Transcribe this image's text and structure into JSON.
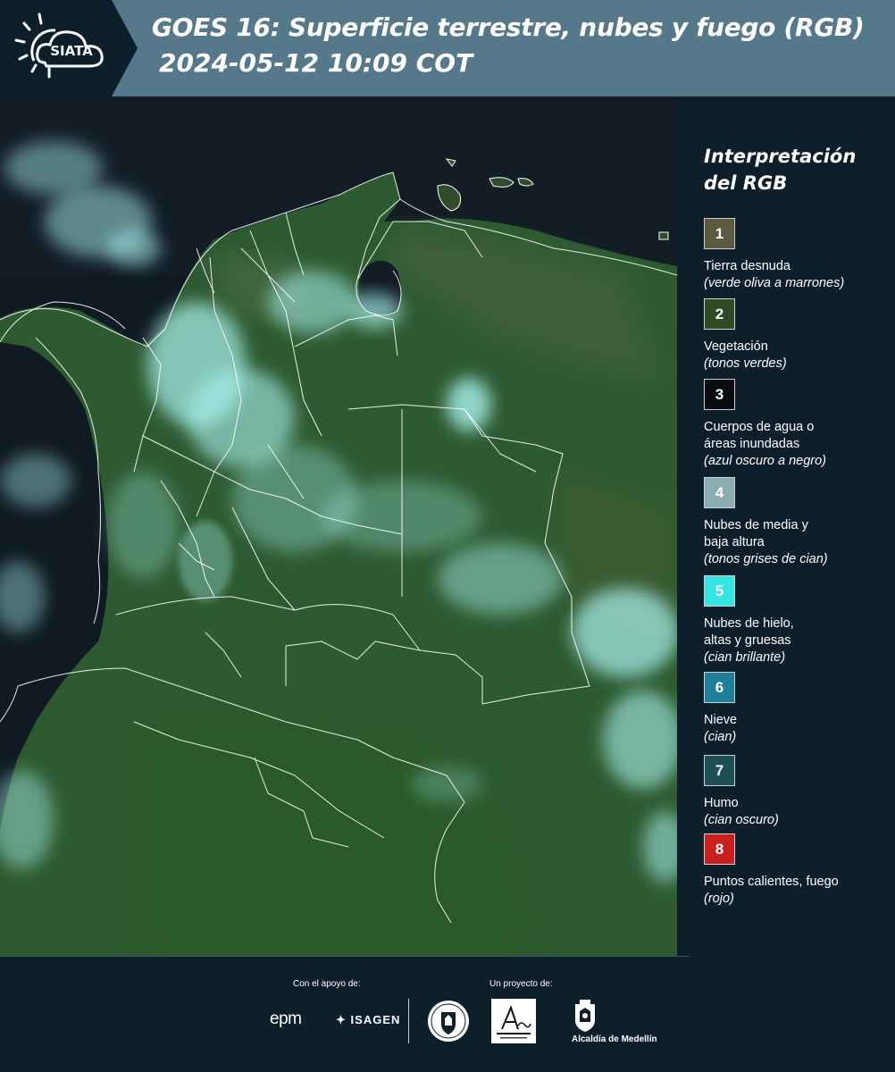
{
  "header": {
    "title": "GOES 16: Superficie terrestre, nubes y fuego (RGB)",
    "datetime": "2024-05-12 10:09 COT",
    "logo_text": "SIATA"
  },
  "legend": {
    "title_line1": "Interpretación",
    "title_line2": "del RGB",
    "items": [
      {
        "number": "1",
        "color": "#5a5a3e",
        "label_lines": [
          "Tierra desnuda"
        ],
        "sub": "(verde oliva a marrones)"
      },
      {
        "number": "2",
        "color": "#2d4a22",
        "label_lines": [
          "Vegetación"
        ],
        "sub": "(tonos verdes)"
      },
      {
        "number": "3",
        "color": "#0a0e12",
        "label_lines": [
          "Cuerpos de agua o",
          "áreas inundadas"
        ],
        "sub": "(azul oscuro a negro)"
      },
      {
        "number": "4",
        "color": "#8aaeb0",
        "label_lines": [
          "Nubes de media y",
          "baja altura"
        ],
        "sub": "(tonos grises de cian)"
      },
      {
        "number": "5",
        "color": "#36e4e4",
        "label_lines": [
          "Nubes de hielo,",
          "altas y gruesas"
        ],
        "sub": "(cian brillante)"
      },
      {
        "number": "6",
        "color": "#1f7e99",
        "label_lines": [
          "Nieve"
        ],
        "sub": "(cian)"
      },
      {
        "number": "7",
        "color": "#1d5055",
        "label_lines": [
          "Humo"
        ],
        "sub": "(cian oscuro)"
      },
      {
        "number": "8",
        "color": "#c8201f",
        "label_lines": [
          "Puntos calientes, fuego"
        ],
        "sub": "(rojo)"
      }
    ]
  },
  "footer": {
    "support_label": "Con el apoyo de:",
    "project_label": "Un proyecto de:",
    "epm": "epm",
    "isagen": "ISAGEN",
    "alcaldia": "Alcaldía de Medellín"
  },
  "colors": {
    "header_bg": "#55798b",
    "logo_panel_bg": "#0d1f2b",
    "page_bg": "#0d1f2b",
    "ocean": "#0e1820",
    "land_green": "#2c5a2e",
    "cloud_cyan": "#8ff0ee",
    "border_white": "#ffffff"
  }
}
